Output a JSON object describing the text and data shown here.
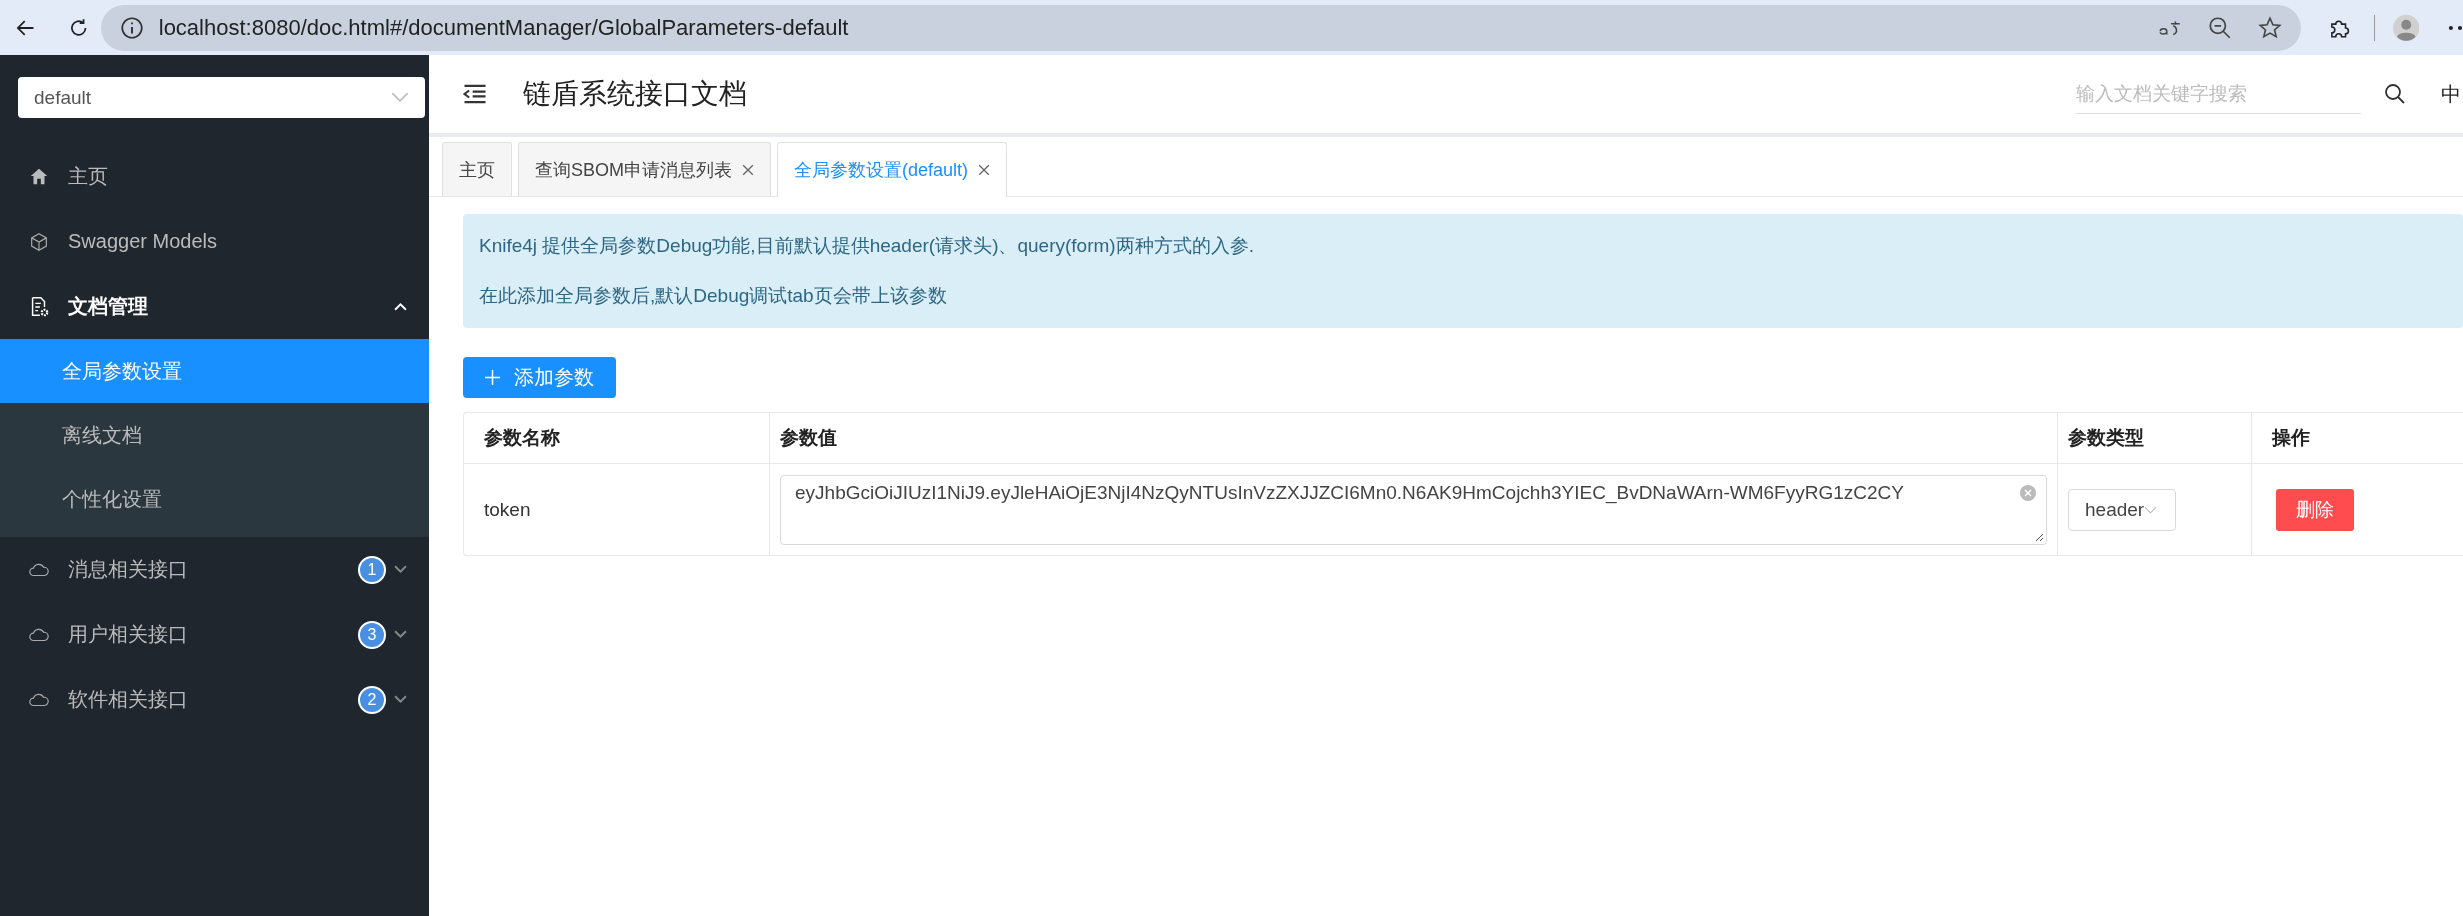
{
  "browser": {
    "url": "localhost:8080/doc.html#/documentManager/GlobalParameters-default"
  },
  "sidebar": {
    "group_select": {
      "value": "default"
    },
    "items": [
      {
        "kind": "home",
        "label": "主页",
        "selected": false
      },
      {
        "kind": "models",
        "label": "Swagger Models",
        "selected": false
      },
      {
        "kind": "docs",
        "label": "文档管理",
        "selected": false,
        "expanded": true,
        "children": [
          {
            "label": "全局参数设置",
            "selected": true
          },
          {
            "label": "离线文档",
            "selected": false
          },
          {
            "label": "个性化设置",
            "selected": false
          }
        ]
      },
      {
        "kind": "api",
        "label": "消息相关接口",
        "badge": "1",
        "selected": false,
        "expanded": false
      },
      {
        "kind": "api",
        "label": "用户相关接口",
        "badge": "3",
        "selected": false,
        "expanded": false
      },
      {
        "kind": "api",
        "label": "软件相关接口",
        "badge": "2",
        "selected": false,
        "expanded": false
      }
    ]
  },
  "header": {
    "title": "链盾系统接口文档",
    "search": {
      "placeholder": "输入文档关键字搜索"
    },
    "language": "中"
  },
  "tabs": [
    {
      "label": "主页",
      "closable": false,
      "selected": false
    },
    {
      "label": "查询SBOM申请消息列表",
      "closable": true,
      "selected": false
    },
    {
      "label": "全局参数设置(default)",
      "closable": true,
      "selected": true
    }
  ],
  "alert": [
    "Knife4j 提供全局参数Debug功能,目前默认提供header(请求头)、query(form)两种方式的入参.",
    "在此添加全局参数后,默认Debug调试tab页会带上该参数"
  ],
  "add_button": "添加参数",
  "table": {
    "columns": [
      "参数名称",
      "参数值",
      "参数类型",
      "操作"
    ],
    "rows": [
      {
        "name": "token",
        "value": "eyJhbGciOiJIUzI1NiJ9.eyJleHAiOjE3NjI4NzQyNTUsInVzZXJJZCI6Mn0.N6AK9HmCojchh3YIEC_BvDNaWArn-WM6FyyRG1zC2CY",
        "type": "header",
        "action": "删除"
      }
    ]
  }
}
